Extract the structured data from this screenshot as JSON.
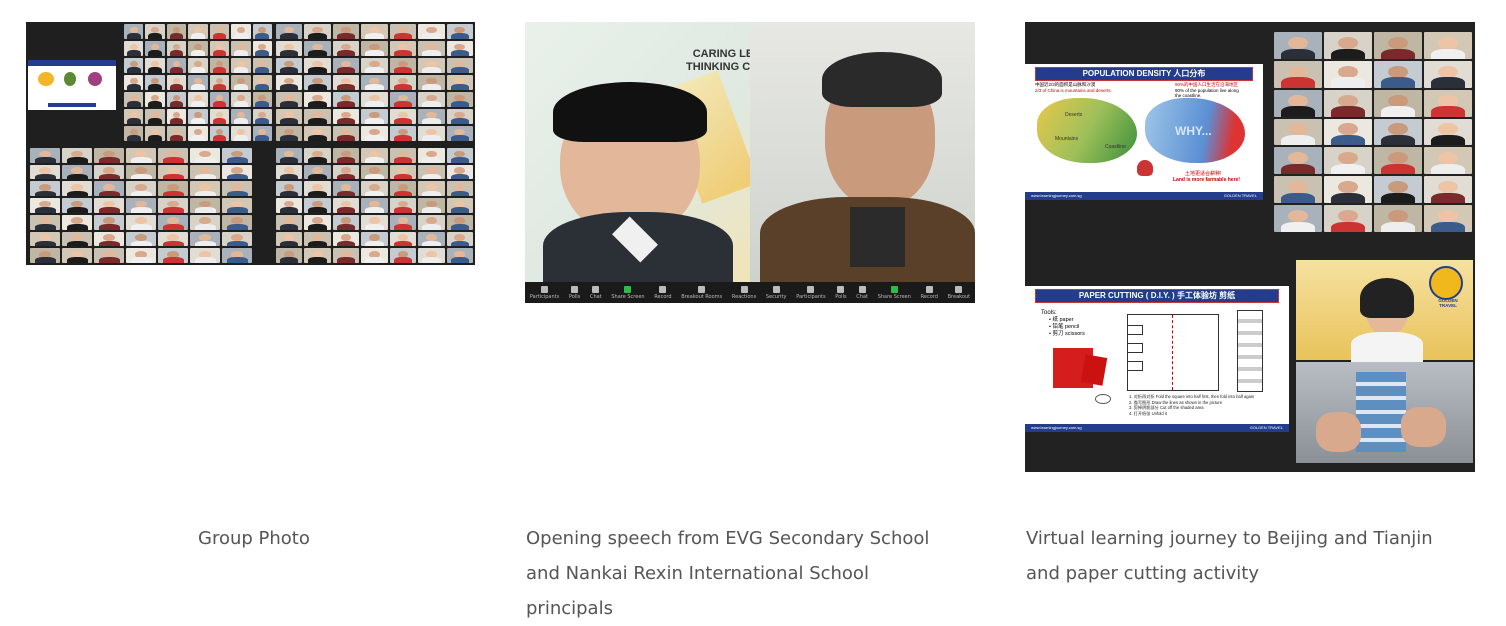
{
  "cards": [
    {
      "caption": "Group Photo"
    },
    {
      "caption": "Opening speech from EVG Secondary School and Nankai Rexin International School principals",
      "backdrop_text": "CARING LE\nTHINKING CI",
      "toolbar": [
        "Participants",
        "Polls",
        "Chat",
        "Share Screen",
        "Record",
        "Breakout Rooms",
        "Reactions",
        "Security",
        "Participants",
        "Polls",
        "Chat",
        "Share Screen",
        "Record",
        "Breakout"
      ]
    },
    {
      "caption": "Virtual learning journey to Beijing and Tianjin and paper cutting activity",
      "slide1": {
        "title": "POPULATION DENSITY 人口分布",
        "line1": "中国近2/3的面积是山脉和沙漠",
        "line2": "2/3 of China is mountains and deserts.",
        "line3": "90%的中国人口生活在沿海地区",
        "line4": "90% of the population live along the coastline.",
        "deserts": "Deserts",
        "mountains": "Mountains",
        "coastline": "Coastline",
        "why": "WHY...",
        "land_cn": "土地更适合耕种!",
        "land_en": "Land is more farmable here!",
        "footer": "www.learningjourney.com.sg",
        "brand": "GOLDEN TRAVEL"
      },
      "slide2": {
        "title": "PAPER CUTTING ( D.I.Y. ) 手工体验坊 剪纸",
        "tools_label": "Tools:",
        "tools": [
          "纸 paper",
          "铅笔 pencil",
          "剪刀 scissors"
        ],
        "steps": [
          "1. 对折再对折 Fold the square into half first, then fold into half again",
          "2. 描写图形 Draw the lines as shown in the picture",
          "3. 剪掉阴影部分 Cut off the shaded area",
          "4. 打开纸张 Unfold it"
        ],
        "footer": "www.learningjourney.com.sg",
        "brand": "GOLDEN TRAVEL"
      },
      "logo_text": "GOLDEN TRAVEL"
    }
  ],
  "colors": {
    "zoom_bg": "#222222",
    "slide_blue": "#233d8c",
    "caption": "#555555"
  }
}
